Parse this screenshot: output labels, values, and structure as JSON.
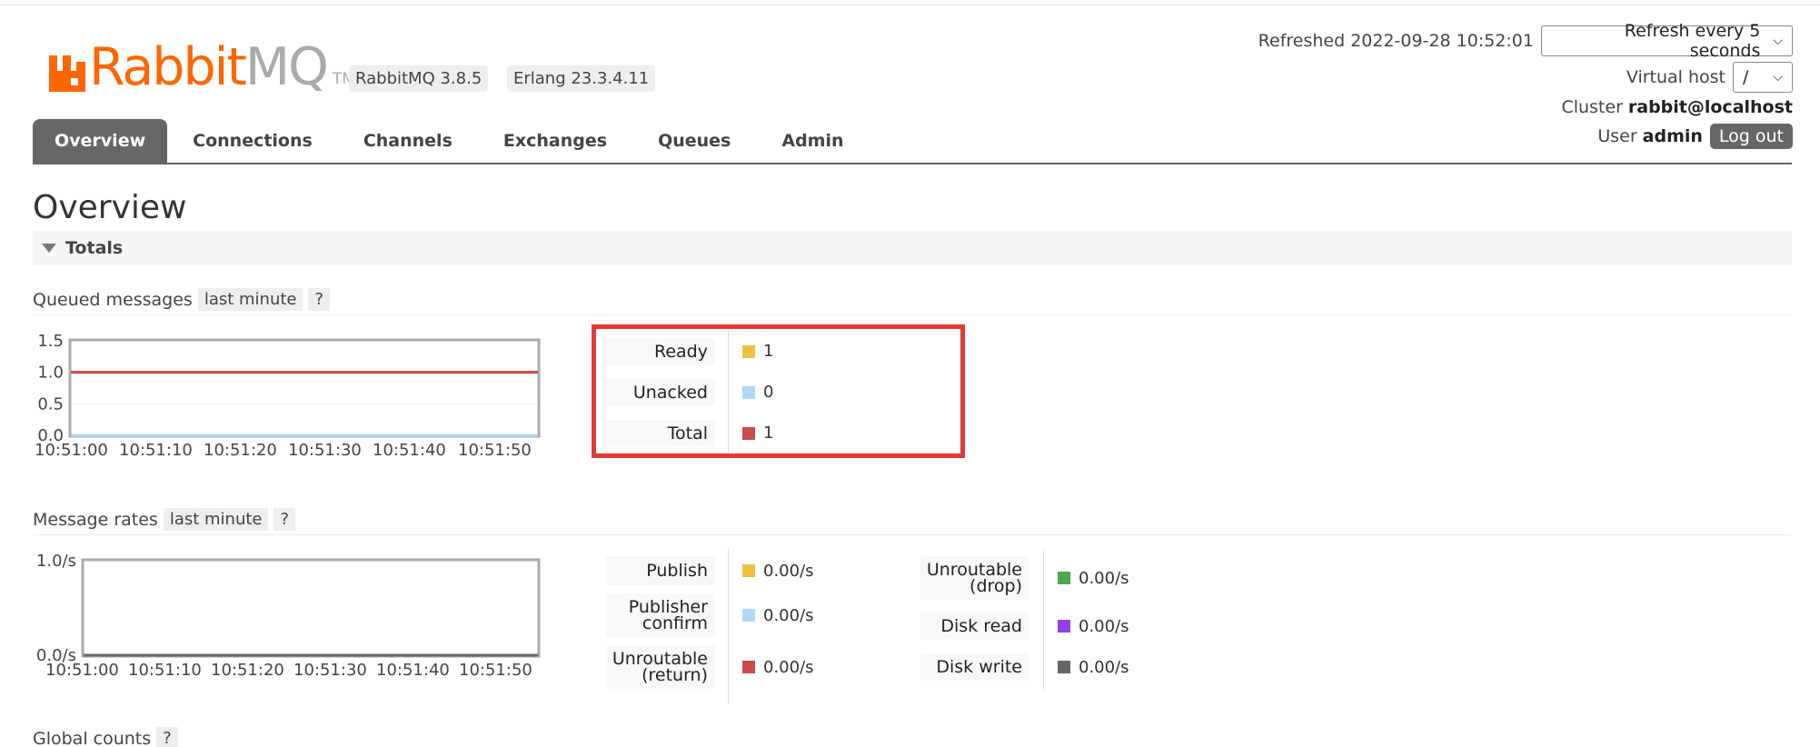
{
  "app": {
    "logo_main": "Rabbit",
    "logo_mq": "MQ",
    "logo_tm": "TM",
    "version": "RabbitMQ 3.8.5",
    "erlang": "Erlang 23.3.4.11"
  },
  "header": {
    "refreshed": "Refreshed 2022-09-28 10:52:01",
    "refresh_option": "Refresh every 5 seconds",
    "virtual_host_label": "Virtual host",
    "virtual_host_value": "/",
    "cluster_label": "Cluster",
    "cluster_value": "rabbit@localhost",
    "user_label": "User",
    "user_value": "admin",
    "logout": "Log out"
  },
  "nav": {
    "tabs": [
      {
        "label": "Overview",
        "active": true
      },
      {
        "label": "Connections",
        "active": false
      },
      {
        "label": "Channels",
        "active": false
      },
      {
        "label": "Exchanges",
        "active": false
      },
      {
        "label": "Queues",
        "active": false
      },
      {
        "label": "Admin",
        "active": false
      }
    ]
  },
  "page": {
    "title": "Overview",
    "section": "Totals"
  },
  "queued": {
    "label": "Queued messages",
    "range": "last minute",
    "help": "?",
    "legend": [
      {
        "label": "Ready",
        "value": "1",
        "color": "#edc240"
      },
      {
        "label": "Unacked",
        "value": "0",
        "color": "#afd8f8"
      },
      {
        "label": "Total",
        "value": "1",
        "color": "#cb4b4b"
      }
    ]
  },
  "rates": {
    "label": "Message rates",
    "range": "last minute",
    "help": "?",
    "legend_left": [
      {
        "label": "Publish",
        "value": "0.00/s",
        "color": "#edc240"
      },
      {
        "label": "Publisher\nconfirm",
        "value": "0.00/s",
        "color": "#afd8f8"
      },
      {
        "label": "Unroutable\n(return)",
        "value": "0.00/s",
        "color": "#cb4b4b"
      }
    ],
    "legend_right": [
      {
        "label": "Unroutable\n(drop)",
        "value": "0.00/s",
        "color": "#4da74d"
      },
      {
        "label": "Disk read",
        "value": "0.00/s",
        "color": "#9440ed"
      },
      {
        "label": "Disk write",
        "value": "0.00/s",
        "color": "#666666"
      }
    ]
  },
  "global": {
    "label": "Global counts",
    "help": "?"
  },
  "chart_data": [
    {
      "type": "line",
      "title": "",
      "x": [
        "10:51:00",
        "10:51:10",
        "10:51:20",
        "10:51:30",
        "10:51:40",
        "10:51:50"
      ],
      "yticks": [
        "0.0",
        "0.5",
        "1.0",
        "1.5"
      ],
      "ylim": [
        0,
        1.5
      ],
      "series": [
        {
          "name": "Ready",
          "values": [
            1,
            1,
            1,
            1,
            1,
            1
          ],
          "color": "#edc240"
        },
        {
          "name": "Unacked",
          "values": [
            0,
            0,
            0,
            0,
            0,
            0
          ],
          "color": "#afd8f8"
        },
        {
          "name": "Total",
          "values": [
            1,
            1,
            1,
            1,
            1,
            1
          ],
          "color": "#cb4b4b"
        }
      ]
    },
    {
      "type": "line",
      "title": "",
      "x": [
        "10:51:00",
        "10:51:10",
        "10:51:20",
        "10:51:30",
        "10:51:40",
        "10:51:50"
      ],
      "yticks": [
        "0.0/s",
        "1.0/s"
      ],
      "ylim": [
        0,
        1
      ],
      "series": [
        {
          "name": "Publish",
          "values": [
            0,
            0,
            0,
            0,
            0,
            0
          ],
          "color": "#edc240"
        },
        {
          "name": "Disk write",
          "values": [
            0,
            0,
            0,
            0,
            0,
            0
          ],
          "color": "#666666"
        }
      ]
    }
  ]
}
